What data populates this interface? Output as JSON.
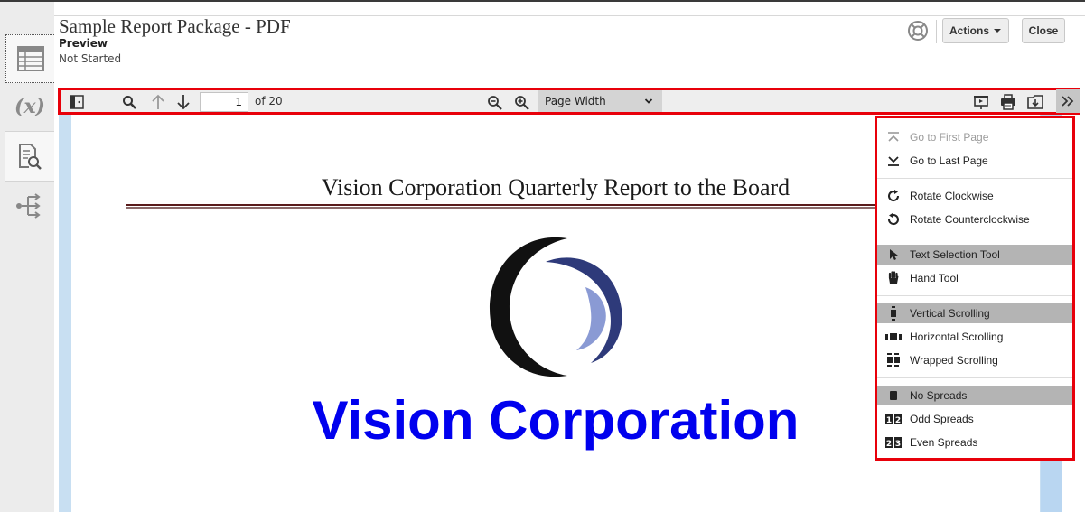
{
  "header": {
    "title": "Sample Report Package - PDF",
    "subtitle": "Preview",
    "status": "Not Started",
    "actions_label": "Actions",
    "close_label": "Close"
  },
  "sidebar": {
    "items": [
      {
        "name": "table-view",
        "icon": "grid-table-icon"
      },
      {
        "name": "variables",
        "icon": "fx-icon",
        "label": "(x)"
      },
      {
        "name": "preview",
        "icon": "document-search-icon"
      },
      {
        "name": "flow",
        "icon": "branch-flow-icon"
      }
    ]
  },
  "toolbar": {
    "page_number": "1",
    "page_total": "of 20",
    "zoom_value": "Page Width",
    "icons": [
      "sidebar-toggle-icon",
      "search-icon",
      "previous-page-icon",
      "next-page-icon",
      "zoom-out-icon",
      "zoom-in-icon",
      "presentation-mode-icon",
      "print-icon",
      "download-icon",
      "more-tools-icon"
    ]
  },
  "document": {
    "title": "Vision Corporation Quarterly Report to the Board",
    "brand": "Vision Corporation"
  },
  "menu": {
    "groups": [
      [
        {
          "label": "Go to First Page",
          "icon": "first-page-icon",
          "disabled": true
        },
        {
          "label": "Go to Last Page",
          "icon": "last-page-icon"
        }
      ],
      [
        {
          "label": "Rotate Clockwise",
          "icon": "rotate-cw-icon"
        },
        {
          "label": "Rotate Counterclockwise",
          "icon": "rotate-ccw-icon"
        }
      ],
      [
        {
          "label": "Text Selection Tool",
          "icon": "cursor-icon",
          "selected": true
        },
        {
          "label": "Hand Tool",
          "icon": "hand-icon"
        }
      ],
      [
        {
          "label": "Vertical Scrolling",
          "icon": "vertical-scroll-icon",
          "selected": true
        },
        {
          "label": "Horizontal Scrolling",
          "icon": "horizontal-scroll-icon"
        },
        {
          "label": "Wrapped Scrolling",
          "icon": "wrapped-scroll-icon"
        }
      ],
      [
        {
          "label": "No Spreads",
          "icon": "no-spreads-icon",
          "selected": true
        },
        {
          "label": "Odd Spreads",
          "icon": "odd-spreads-icon"
        },
        {
          "label": "Even Spreads",
          "icon": "even-spreads-icon"
        }
      ]
    ]
  },
  "colors": {
    "highlight_border": "#e8000a",
    "brand_blue": "#0000ee",
    "viewer_bg": "#c8dff2"
  }
}
